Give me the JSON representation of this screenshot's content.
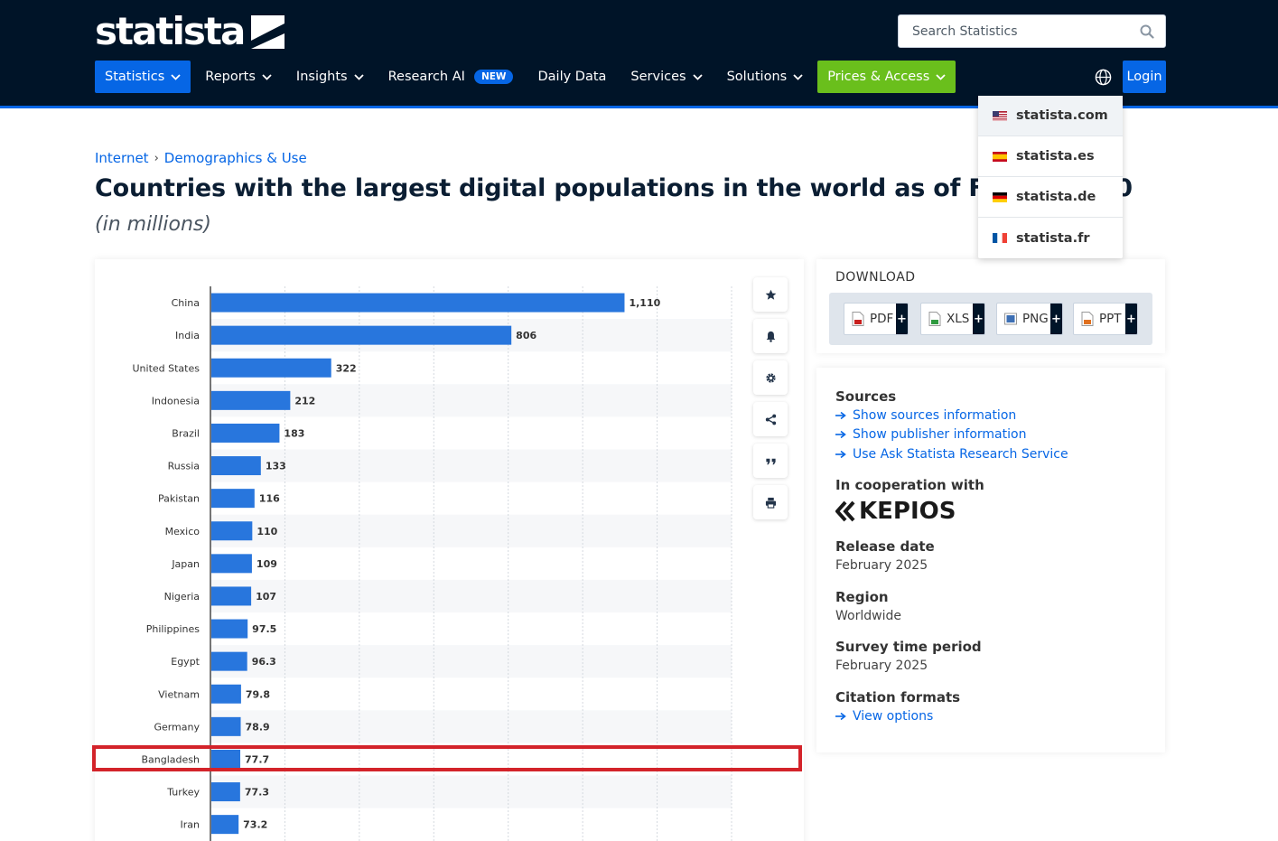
{
  "header": {
    "logo_text": "statista",
    "search_placeholder": "Search Statistics",
    "nav": [
      {
        "label": "Statistics"
      },
      {
        "label": "Reports"
      },
      {
        "label": "Insights"
      },
      {
        "label": "Research AI",
        "badge": "NEW"
      },
      {
        "label": "Daily Data"
      },
      {
        "label": "Services"
      },
      {
        "label": "Solutions"
      },
      {
        "label": "Prices & Access"
      }
    ],
    "login_label": "Login"
  },
  "lang_menu": [
    {
      "label": "statista.com"
    },
    {
      "label": "statista.es"
    },
    {
      "label": "statista.de"
    },
    {
      "label": "statista.fr"
    }
  ],
  "breadcrumb": [
    "Internet",
    "Demographics & Use"
  ],
  "page": {
    "title": "Countries with the largest digital populations in the world as of February 20",
    "subtitle": "(in millions)"
  },
  "chart_data": {
    "type": "bar",
    "orientation": "horizontal",
    "categories": [
      "China",
      "India",
      "United States",
      "Indonesia",
      "Brazil",
      "Russia",
      "Pakistan",
      "Mexico",
      "Japan",
      "Nigeria",
      "Philippines",
      "Egypt",
      "Vietnam",
      "Germany",
      "Bangladesh",
      "Turkey",
      "Iran"
    ],
    "values": [
      1110,
      806,
      322,
      212,
      183,
      133,
      116,
      110,
      109,
      107,
      97.5,
      96.3,
      79.8,
      78.9,
      77.7,
      77.3,
      73.2
    ],
    "value_labels": [
      "1,110",
      "806",
      "322",
      "212",
      "183",
      "133",
      "116",
      "110",
      "109",
      "107",
      "97.5",
      "96.3",
      "79.8",
      "78.9",
      "77.7",
      "77.3",
      "73.2"
    ],
    "highlighted": "Bangladesh",
    "xlim": [
      0,
      1400
    ],
    "bar_color": "#2876dd",
    "grid": true
  },
  "download": {
    "title": "DOWNLOAD",
    "buttons": [
      {
        "label": "PDF"
      },
      {
        "label": "XLS"
      },
      {
        "label": "PNG"
      },
      {
        "label": "PPT"
      }
    ],
    "plus": "+"
  },
  "info": {
    "sources_heading": "Sources",
    "links": [
      "Show sources information",
      "Show publisher information",
      "Use Ask Statista Research Service"
    ],
    "cooperation_heading": "In cooperation with",
    "cooperation_logo": "KEPIOS",
    "release_heading": "Release date",
    "release_value": "February 2025",
    "region_heading": "Region",
    "region_value": "Worldwide",
    "survey_heading": "Survey time period",
    "survey_value": "February 2025",
    "citation_heading": "Citation formats",
    "citation_link": "View options"
  },
  "colors": {
    "header_bg": "#001428",
    "accent": "#0666e5",
    "prices_green": "#6abf1c",
    "highlight_red": "#d3232a"
  }
}
